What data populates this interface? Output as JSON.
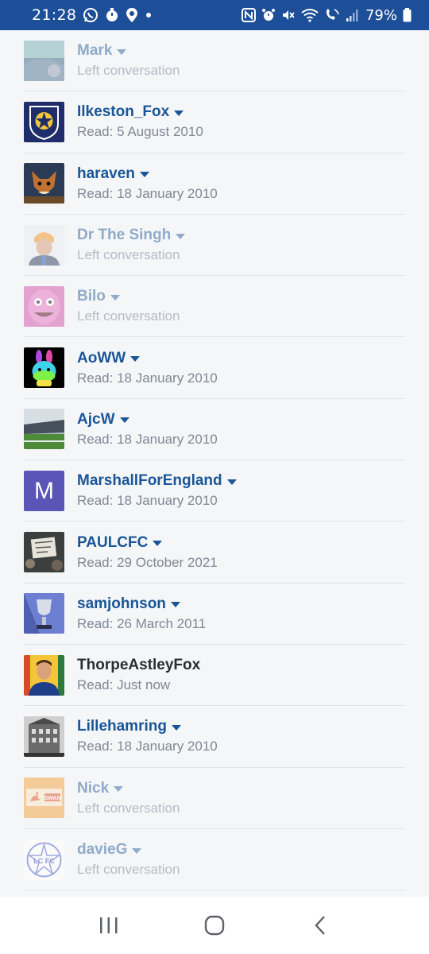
{
  "status_bar": {
    "time": "21:28",
    "battery": "79%",
    "background": "#1d4f99"
  },
  "participants": [
    {
      "name": "Mark",
      "status": "Left conversation",
      "left": true,
      "has_menu": true,
      "avatar_icon": "photo-avatar"
    },
    {
      "name": "Ilkeston_Fox",
      "status": "Read: 5 August 2010",
      "left": false,
      "has_menu": true,
      "avatar_icon": "crest-avatar"
    },
    {
      "name": "haraven",
      "status": "Read: 18 January 2010",
      "left": false,
      "has_menu": true,
      "avatar_icon": "fox-avatar"
    },
    {
      "name": "Dr The Singh",
      "status": "Left conversation",
      "left": true,
      "has_menu": true,
      "avatar_icon": "person-avatar"
    },
    {
      "name": "Bilo",
      "status": "Left conversation",
      "left": true,
      "has_menu": true,
      "avatar_icon": "face-avatar"
    },
    {
      "name": "AoWW",
      "status": "Read: 18 January 2010",
      "left": false,
      "has_menu": true,
      "avatar_icon": "rainbow-bunny-avatar"
    },
    {
      "name": "AjcW",
      "status": "Read: 18 January 2010",
      "left": false,
      "has_menu": true,
      "avatar_icon": "stadium-avatar"
    },
    {
      "name": "MarshallForEngland",
      "status": "Read: 18 January 2010",
      "left": false,
      "has_menu": true,
      "avatar_icon": "letter-avatar",
      "avatar_letter": "M",
      "avatar_color": "#5b55b8"
    },
    {
      "name": "PAULCFC",
      "status": "Read: 29 October 2021",
      "left": false,
      "has_menu": true,
      "avatar_icon": "banner-avatar"
    },
    {
      "name": "samjohnson",
      "status": "Read: 26 March 2011",
      "left": false,
      "has_menu": true,
      "avatar_icon": "trophy-avatar"
    },
    {
      "name": "ThorpeAstleyFox",
      "status": "Read: Just now",
      "left": false,
      "has_menu": false,
      "self": true,
      "avatar_icon": "footballer-avatar"
    },
    {
      "name": "Lillehamring",
      "status": "Read: 18 January 2010",
      "left": false,
      "has_menu": true,
      "avatar_icon": "building-avatar"
    },
    {
      "name": "Nick",
      "status": "Left conversation",
      "left": true,
      "has_menu": true,
      "avatar_icon": "swan-avatar",
      "avatar_label": "SWAN"
    },
    {
      "name": "davieG",
      "status": "Left conversation",
      "left": true,
      "has_menu": true,
      "avatar_icon": "lcfc-badge-avatar",
      "avatar_label": "LC FC"
    }
  ]
}
